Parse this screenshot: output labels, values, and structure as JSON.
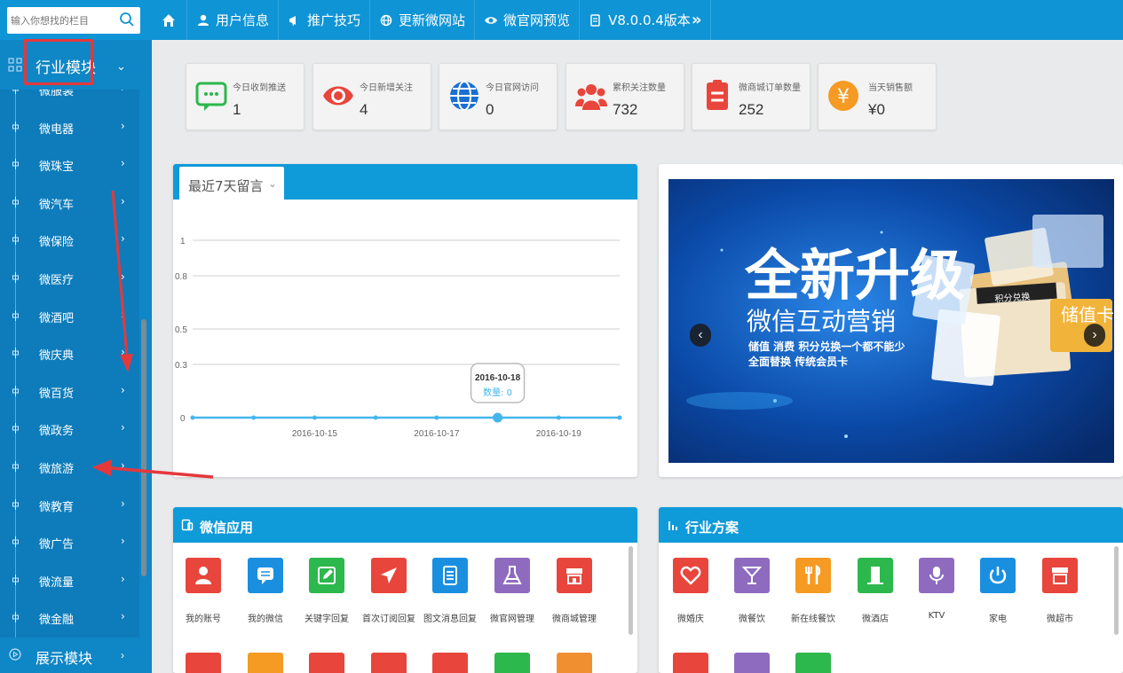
{
  "search": {
    "placeholder": "输入你想找的栏目"
  },
  "topnav": [
    {
      "label": "用户信息",
      "icon": "user-icon"
    },
    {
      "label": "推广技巧",
      "icon": "megaphone-icon"
    },
    {
      "label": "更新微网站",
      "icon": "globe-icon"
    },
    {
      "label": "微官网预览",
      "icon": "eye-icon"
    },
    {
      "label": "V8.0.0.4版本",
      "icon": "version-icon",
      "suffix": "»"
    }
  ],
  "sidebar": {
    "title": "行业模块",
    "items": [
      "微服装",
      "微电器",
      "微珠宝",
      "微汽车",
      "微保险",
      "微医疗",
      "微酒吧",
      "微庆典",
      "微百货",
      "微政务",
      "微旅游",
      "微教育",
      "微广告",
      "微流量",
      "微金融"
    ],
    "footer": "展示模块"
  },
  "stats": [
    {
      "label": "今日收到推送",
      "value": "1",
      "icon": "message-icon",
      "color": "#2cb84c"
    },
    {
      "label": "今日新增关注",
      "value": "4",
      "icon": "eye-icon",
      "color": "#e8453c"
    },
    {
      "label": "今日官网访问",
      "value": "0",
      "icon": "globe-icon",
      "color": "#1a6fd0"
    },
    {
      "label": "累积关注数量",
      "value": "732",
      "icon": "users-icon",
      "color": "#e8453c"
    },
    {
      "label": "微商城订单数量",
      "value": "252",
      "icon": "clipboard-icon",
      "color": "#e8453c"
    },
    {
      "label": "当天销售额",
      "value": "¥0",
      "icon": "yen-icon",
      "color": "#f59a23"
    }
  ],
  "chart_panel": {
    "dropdown": "最近7天留言"
  },
  "chart_data": {
    "type": "line",
    "x": [
      "2016-10-13",
      "2016-10-14",
      "2016-10-15",
      "2016-10-16",
      "2016-10-17",
      "2016-10-18",
      "2016-10-19",
      "2016-10-20"
    ],
    "x_tick_labels": [
      "2016-10-15",
      "2016-10-17",
      "2016-10-19"
    ],
    "series": [
      {
        "values": [
          0,
          0,
          0,
          0,
          0,
          0,
          0,
          0
        ]
      }
    ],
    "y_ticks": [
      "0",
      "0.3",
      "0.5",
      "0.8",
      "1"
    ],
    "ylim": [
      0,
      1
    ],
    "tooltip": {
      "date": "2016-10-18",
      "text": "数量: 0"
    },
    "grid": true,
    "color": "#45b6ec"
  },
  "banner": {
    "headline": "全新升级",
    "subhead": "微信互动营销",
    "line1": "储值 消费 积分兑换一个都不能少",
    "line2": "全面替换 传统会员卡",
    "badge": "储值卡",
    "card_label": "积分兑换"
  },
  "app_panel": {
    "title": "微信应用",
    "items": [
      {
        "label": "我的账号",
        "color": "#e8453c",
        "icon": "person-icon"
      },
      {
        "label": "我的微信",
        "color": "#1a8fe0",
        "icon": "chat-icon"
      },
      {
        "label": "关键字回复",
        "color": "#2cb84c",
        "icon": "edit-icon"
      },
      {
        "label": "首次订阅回复",
        "color": "#e8453c",
        "icon": "send-icon"
      },
      {
        "label": "图文消息回复",
        "color": "#1a8fe0",
        "icon": "document-icon"
      },
      {
        "label": "微官网管理",
        "color": "#8e6bbf",
        "icon": "flask-icon"
      },
      {
        "label": "微商城管理",
        "color": "#e8453c",
        "icon": "store-icon"
      }
    ],
    "row2_colors": [
      "#e8453c",
      "#f59a23",
      "#e8453c",
      "#e8453c",
      "#e8453c",
      "#2cb84c",
      "#f08f30"
    ]
  },
  "ind_panel": {
    "title": "行业方案",
    "items": [
      {
        "label": "微婚庆",
        "color": "#e8453c",
        "icon": "heart-icon"
      },
      {
        "label": "微餐饮",
        "color": "#8e6bbf",
        "icon": "cocktail-icon"
      },
      {
        "label": "新在线餐饮",
        "color": "#f59a23",
        "icon": "cutlery-icon"
      },
      {
        "label": "微酒店",
        "color": "#2cb84c",
        "icon": "building-icon"
      },
      {
        "label": "KTV",
        "color": "#8e6bbf",
        "icon": "microphone-icon"
      },
      {
        "label": "家电",
        "color": "#1a8fe0",
        "icon": "power-icon"
      },
      {
        "label": "微超市",
        "color": "#e8453c",
        "icon": "shop-icon"
      }
    ],
    "row2_colors": [
      "#e8453c",
      "#8e6bbf",
      "#2cb84c"
    ]
  }
}
